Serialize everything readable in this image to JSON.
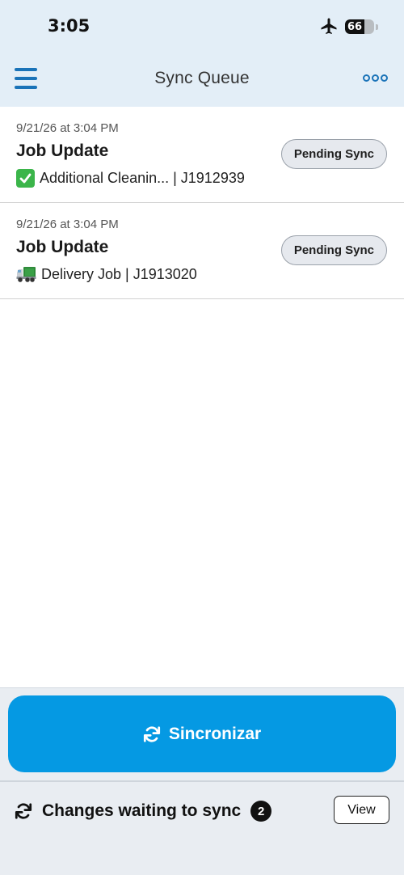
{
  "status_bar": {
    "time": "3:05",
    "battery_level": "66",
    "battery_fraction": 0.66,
    "airplane_mode_icon": "airplane-icon"
  },
  "header": {
    "title": "Sync Queue",
    "menu_icon": "hamburger-menu-icon",
    "more_icon": "more-options-icon"
  },
  "queue_items": [
    {
      "date": "9/21/26 at 3:04 PM",
      "title": "Job Update",
      "icon": "check-mark-icon",
      "subtitle": "Additional Cleanin... | J1912939",
      "status": "Pending Sync"
    },
    {
      "date": "9/21/26 at 3:04 PM",
      "title": "Job Update",
      "icon": "delivery-truck-icon",
      "subtitle": "Delivery Job | J1913020",
      "status": "Pending Sync"
    }
  ],
  "actions": {
    "sync_label": "Sincronizar",
    "sync_icon": "sync-icon"
  },
  "footer": {
    "text": "Changes waiting to sync",
    "count": "2",
    "view_label": "View"
  },
  "colors": {
    "accent": "#0599e3",
    "header_bg": "#e3eef7",
    "icon_blue": "#1a73b8"
  }
}
